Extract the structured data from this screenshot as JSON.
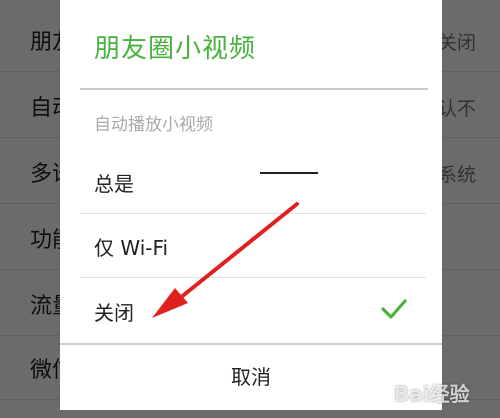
{
  "background": {
    "rows": [
      {
        "left": "朋友",
        "right": "关闭"
      },
      {
        "left": "自动",
        "right": "认不"
      },
      {
        "left": "多语",
        "right": "系统"
      },
      {
        "left": "功能",
        "right": ""
      },
      {
        "left": "流量",
        "right": ""
      },
      {
        "left": "微信",
        "right": ""
      }
    ]
  },
  "dialog": {
    "title": "朋友圈小视频",
    "section_label": "自动播放小视频",
    "options": [
      {
        "label": "总是",
        "selected": false
      },
      {
        "label": "仅 Wi-Fi",
        "selected": false
      },
      {
        "label": "关闭",
        "selected": true
      }
    ],
    "cancel_label": "取消"
  },
  "colors": {
    "accent_green": "#46b33c",
    "arrow_red": "#e0221f"
  },
  "watermark": {
    "text": "Bai经验"
  }
}
